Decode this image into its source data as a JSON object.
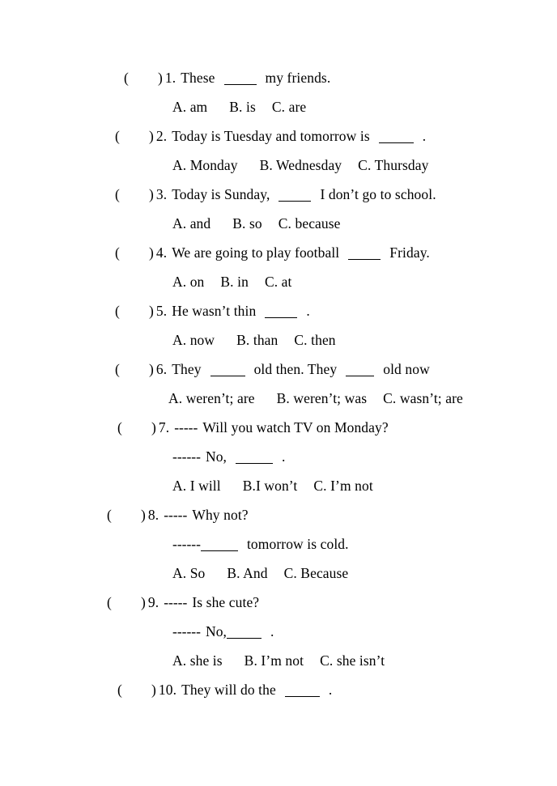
{
  "document": {
    "type": "english-grammar-worksheet",
    "questions": [
      {
        "checkbox_open": "(",
        "checkbox_close": ")",
        "number": "1.",
        "stem_before": "These",
        "stem_after": "my friends.",
        "options": [
          "A. am",
          "B. is",
          "C. are"
        ],
        "indent": 153
      },
      {
        "checkbox_open": "(",
        "checkbox_close": ")",
        "number": "2.",
        "stem_before": "Today is Tuesday and tomorrow is",
        "stem_after": ".",
        "options": [
          "A. Monday",
          "B. Wednesday",
          "C. Thursday"
        ],
        "indent": 142
      },
      {
        "checkbox_open": "(",
        "checkbox_close": ")",
        "number": "3.",
        "stem_before": "Today is Sunday,",
        "stem_after": "I don’t go to school.",
        "options": [
          "A. and",
          "B. so",
          "C. because"
        ],
        "indent": 142
      },
      {
        "checkbox_open": "(",
        "checkbox_close": ")",
        "number": "4.",
        "stem_before": "We are going to play football",
        "stem_after": "Friday.",
        "options": [
          "A. on",
          "B. in",
          "C. at"
        ],
        "indent": 142
      },
      {
        "checkbox_open": "(",
        "checkbox_close": ")",
        "number": "5.",
        "stem_before": "He wasn’t thin",
        "stem_after": ".",
        "options": [
          "A. now",
          "B. than",
          "C. then"
        ],
        "indent": 142
      },
      {
        "checkbox_open": "(",
        "checkbox_close": ")",
        "number": "6.",
        "stem_before": "They",
        "stem_middle": "old then. They",
        "stem_after": "old now",
        "options": [
          "A. weren’t; are",
          "B. weren’t; was",
          "C. wasn’t; are"
        ],
        "indent": 142
      },
      {
        "checkbox_open": "(",
        "checkbox_close": ")",
        "number": "7.",
        "dash_prefix": "-----",
        "stem_before": "Will you watch TV on Monday?",
        "answer_dash": "------",
        "answer_before": "No,",
        "answer_after": ".",
        "options": [
          "A. I will",
          "B.I won’t",
          "C. I’m not"
        ],
        "indent": 145
      },
      {
        "checkbox_open": "(",
        "checkbox_close": ")",
        "number": "8.",
        "dash_prefix": "-----",
        "stem_before": "Why not?",
        "answer_dash": "------",
        "answer_after": "tomorrow is cold.",
        "options": [
          "A. So",
          "B. And",
          "C. Because"
        ],
        "indent": 132
      },
      {
        "checkbox_open": "(",
        "checkbox_close": ")",
        "number": "9.",
        "dash_prefix": "-----",
        "stem_before": "Is she cute?",
        "answer_dash": "------",
        "answer_before": "No,",
        "answer_after": ".",
        "options": [
          "A. she is",
          "B. I’m not",
          "C. she isn’t"
        ],
        "indent": 132
      },
      {
        "checkbox_open": "(",
        "checkbox_close": ")",
        "number": "10.",
        "stem_before": "They will do the",
        "stem_after": ".",
        "options": [],
        "indent": 145
      }
    ]
  }
}
